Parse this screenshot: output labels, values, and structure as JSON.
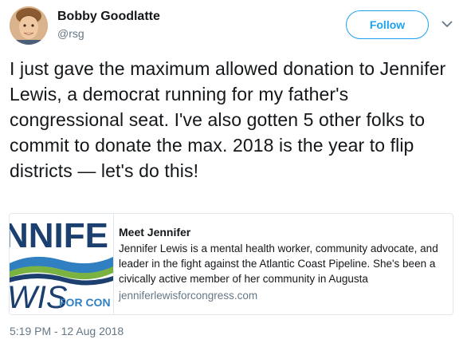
{
  "author": {
    "display_name": "Bobby Goodlatte",
    "handle": "@rsg"
  },
  "follow_button": {
    "label": "Follow"
  },
  "tweet": {
    "text": "I just gave the maximum allowed donation to Jennifer Lewis, a democrat running for my father's congressional seat. I've also gotten 5 other folks to commit to donate the max. 2018 is the year to flip districts — let's do this!"
  },
  "card": {
    "image_text_top": "NNIFE",
    "image_text_bottom": "WIS",
    "image_text_tag": "FOR CON",
    "title": "Meet Jennifer",
    "description": "Jennifer Lewis is a mental health worker, community advocate, and leader in the fight against the Atlantic Coast Pipeline. She's been a civically active member of her community in Augusta",
    "domain": "jenniferlewisforcongress.com"
  },
  "timestamp": "5:19 PM - 12 Aug 2018",
  "colors": {
    "accent": "#1da1f2",
    "text": "#14171a",
    "muted": "#657786",
    "border": "#e1e8ed",
    "logo_navy": "#1b3f6e",
    "logo_blue": "#2f7fc1",
    "logo_green": "#7bb342"
  },
  "icons": {
    "caret": "chevron-down-icon"
  }
}
